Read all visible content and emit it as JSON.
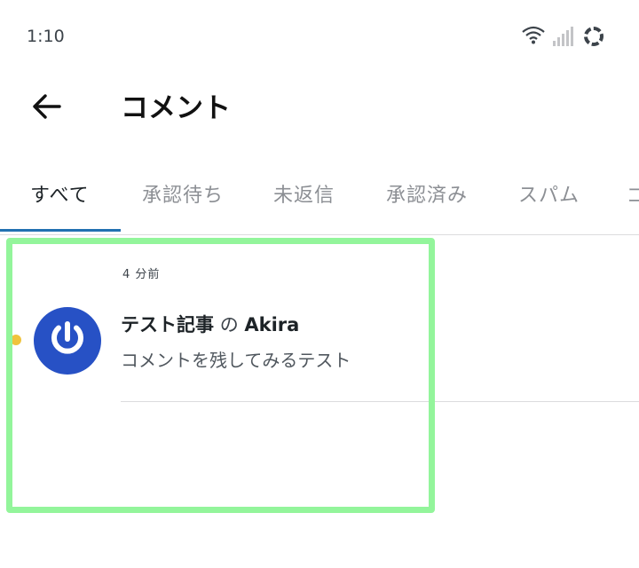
{
  "status_bar": {
    "time": "1:10",
    "icons": [
      "wifi-icon",
      "signal-icon",
      "loading-icon"
    ]
  },
  "app_bar": {
    "back_icon": "arrow-left-icon",
    "title": "コメント"
  },
  "tabs": [
    {
      "label": "すべて",
      "active": true
    },
    {
      "label": "承認待ち",
      "active": false
    },
    {
      "label": "未返信",
      "active": false
    },
    {
      "label": "承認済み",
      "active": false
    },
    {
      "label": "スパム",
      "active": false
    },
    {
      "label": "ゴ",
      "active": false
    }
  ],
  "comment": {
    "time": "4 分前",
    "post_title": "テスト記事",
    "connector": "の",
    "author": "Akira",
    "excerpt": "コメントを残してみるテスト",
    "avatar_icon": "gravatar-power-icon",
    "unread_indicator": true
  },
  "colors": {
    "accent": "#2271b1",
    "avatar_bg": "#2751c5",
    "unread_dot": "#f0c33c",
    "highlight": "#93f59b"
  }
}
